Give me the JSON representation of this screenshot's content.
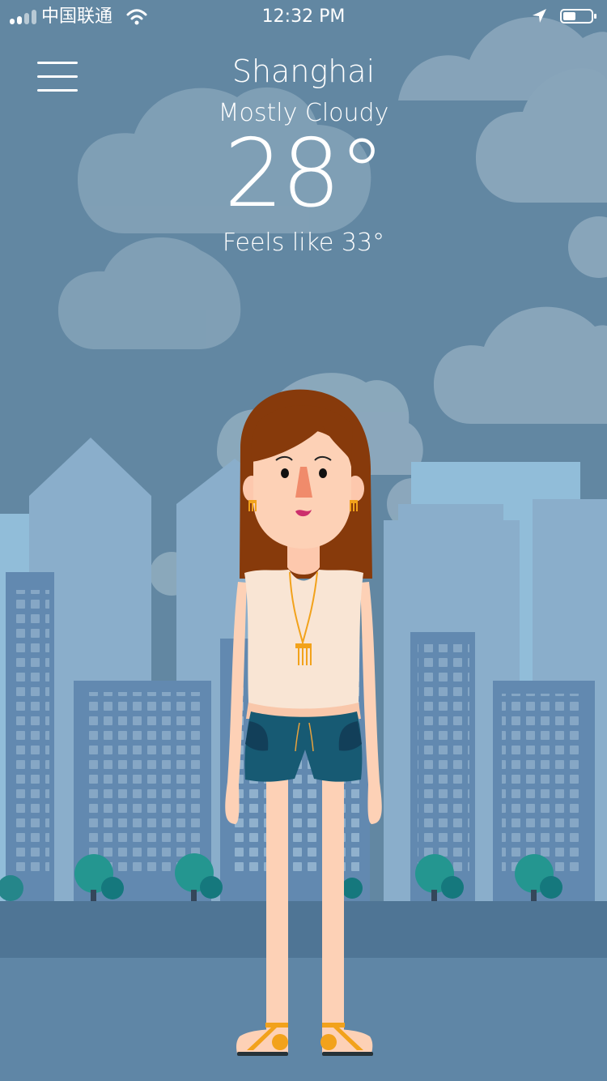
{
  "status_bar": {
    "carrier": "中国联通",
    "time": "12:32 PM",
    "icons": [
      "signal-icon",
      "wifi-icon",
      "location-arrow-icon",
      "battery-icon"
    ]
  },
  "header": {
    "menu_icon": "hamburger-menu-icon"
  },
  "weather": {
    "city": "Shanghai",
    "condition": "Mostly Cloudy",
    "temperature": "28°",
    "feels_like": "Feels like 33°"
  },
  "illustration": {
    "subject": "woman-outfit",
    "colors": {
      "sky": "#5f7f98",
      "cloud": "#8ea8ba",
      "building": "#7f9fbc",
      "building_dark": "#5f87ad",
      "ground": "#4d7394",
      "skin": "#fdd1b6",
      "hair": "#873a0b",
      "top": "#f9e5d4",
      "shorts": "#175a73",
      "gold": "#f2a21b"
    }
  }
}
